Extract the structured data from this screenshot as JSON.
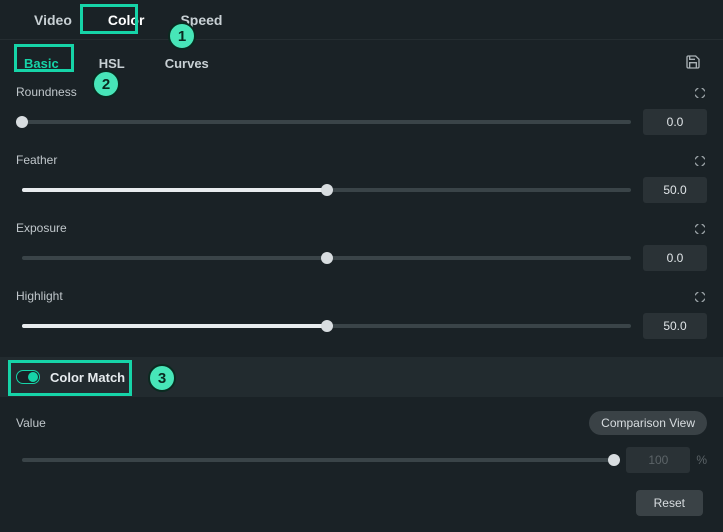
{
  "topTabs": {
    "video": "Video",
    "color": "Color",
    "speed": "Speed"
  },
  "subTabs": {
    "basic": "Basic",
    "hsl": "HSL",
    "curves": "Curves"
  },
  "sliders": {
    "roundness": {
      "label": "Roundness",
      "value": "0.0",
      "percent": 0
    },
    "feather": {
      "label": "Feather",
      "value": "50.0",
      "percent": 50
    },
    "exposure": {
      "label": "Exposure",
      "value": "0.0",
      "percent": 50
    },
    "highlight": {
      "label": "Highlight",
      "value": "50.0",
      "percent": 50
    }
  },
  "colorMatch": {
    "title": "Color Match",
    "on": true,
    "valueLabel": "Value",
    "value": "100",
    "percentSuffix": "%",
    "comparisonButton": "Comparison View"
  },
  "resetButton": "Reset",
  "annotations": {
    "b1": "1",
    "b2": "2",
    "b3": "3"
  }
}
